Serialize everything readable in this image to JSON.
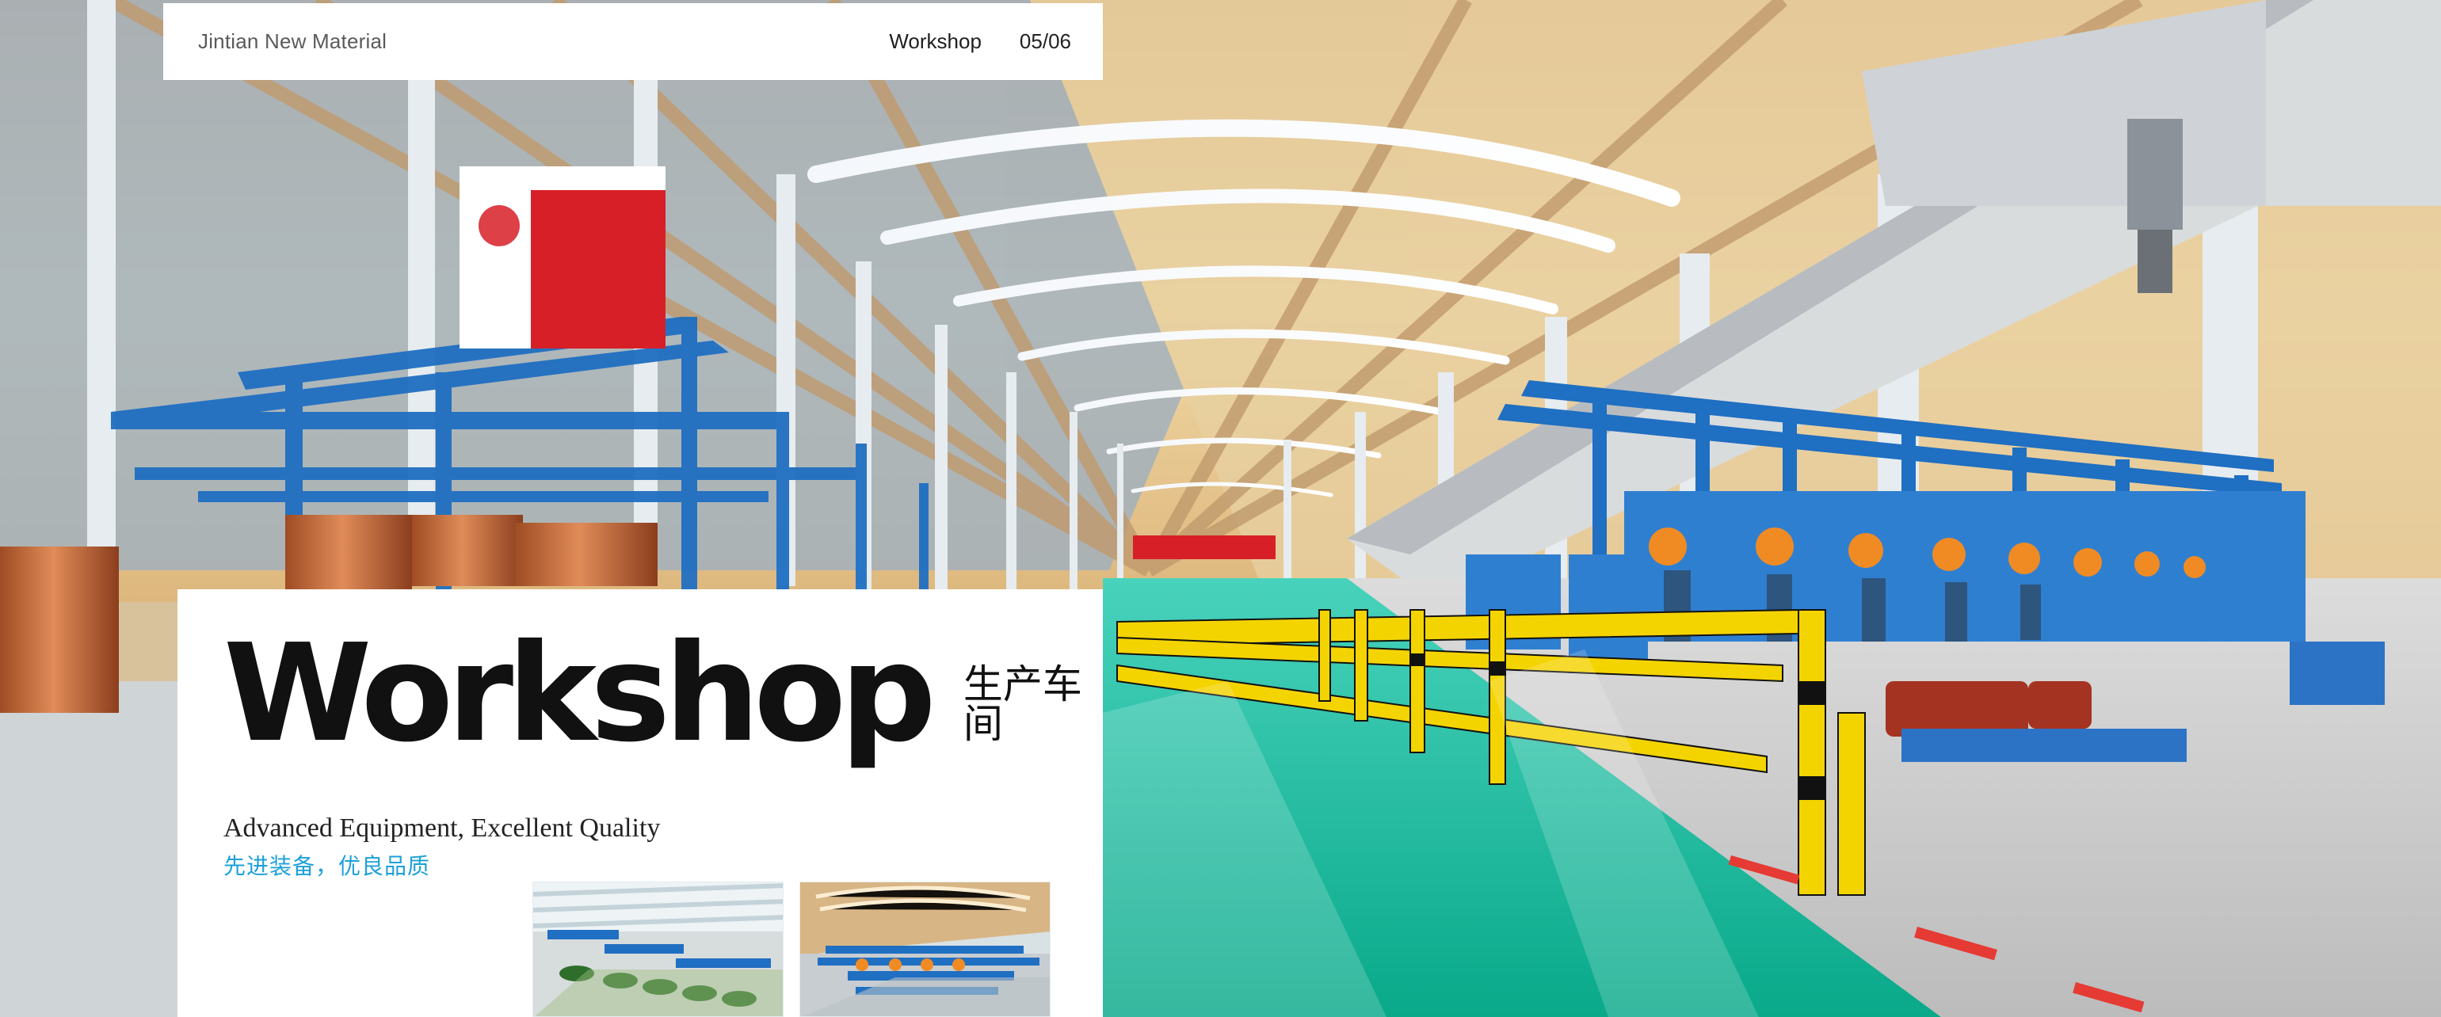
{
  "header": {
    "brand": "Jintian New Material",
    "section": "Workshop",
    "page": "05/06"
  },
  "hero": {
    "title": "Workshop",
    "title_cn": "生产车间",
    "subtitle_en": "Advanced Equipment, Excellent Quality",
    "subtitle_cn": "先进装备，优良品质"
  },
  "colors": {
    "accent_blue": "#1DA0D8",
    "floor_green": "#19B99A",
    "machine_blue": "#1F6FC2",
    "safety_yellow": "#F4D400"
  }
}
